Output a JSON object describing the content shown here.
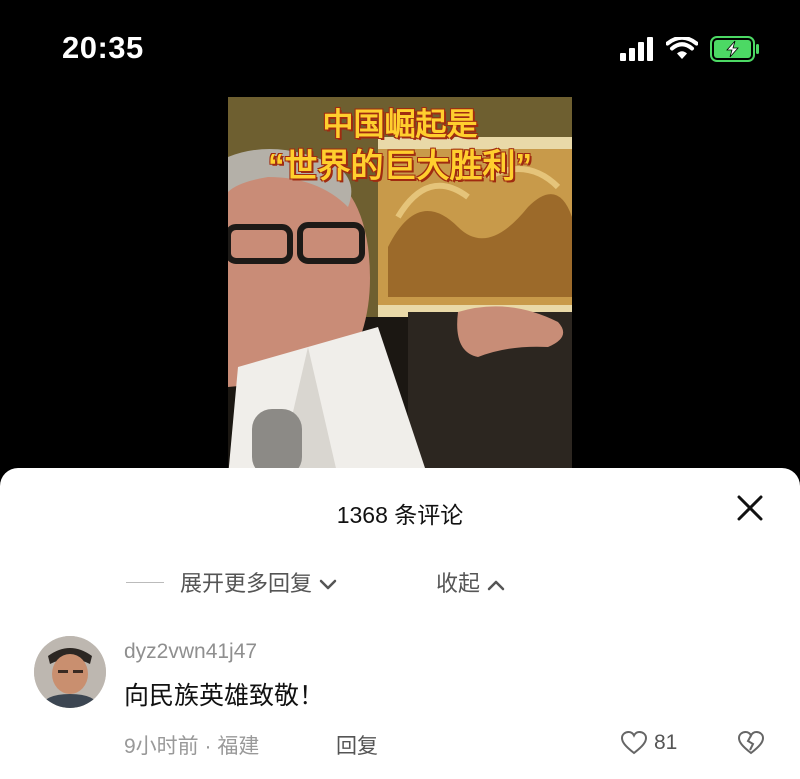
{
  "status_bar": {
    "time": "20:35"
  },
  "video": {
    "title_line1": "中国崛起是",
    "title_line2": "“世界的巨大胜利”"
  },
  "comments_sheet": {
    "title": "1368 条评论",
    "expand_more_label": "展开更多回复",
    "collapse_label": "收起",
    "comment": {
      "username": "dyz2vwn41j47",
      "text": "向民族英雄致敬！",
      "meta": "9小时前 · 福建",
      "reply_label": "回复",
      "like_count": "81"
    }
  },
  "colors": {
    "title_yellow": "#ffcf2e",
    "battery_green": "#4cd964"
  }
}
